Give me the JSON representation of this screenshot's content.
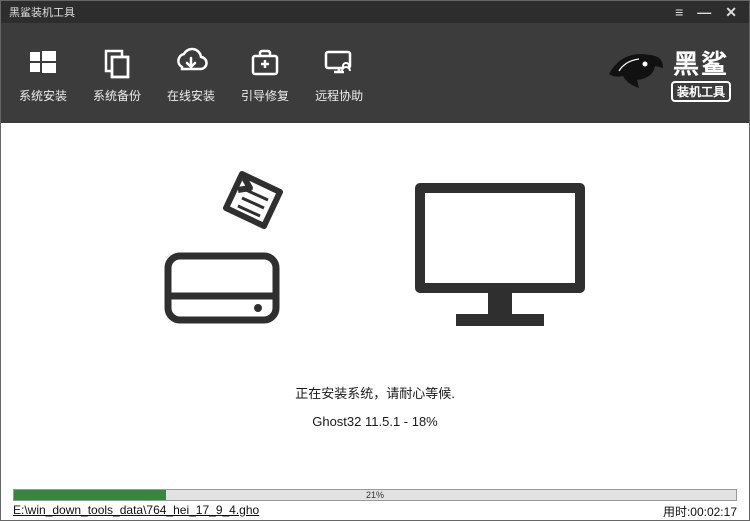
{
  "titlebar": {
    "title": "黑鲨装机工具"
  },
  "tabs": {
    "install": {
      "label": "系统安装"
    },
    "backup": {
      "label": "系统备份"
    },
    "online": {
      "label": "在线安装"
    },
    "bootfix": {
      "label": "引导修复"
    },
    "remote": {
      "label": "远程协助"
    }
  },
  "logo": {
    "brand_big": "黑鲨",
    "brand_small": "装机工具"
  },
  "status": {
    "line1": "正在安装系统，请耐心等候.",
    "line2": "Ghost32 11.5.1 - 18%"
  },
  "progress": {
    "percent": 21,
    "percent_label": "21%",
    "file_path": "E:\\win_down_tools_data\\764_hei_17_9_4.gho",
    "elapsed_prefix": "用时:",
    "elapsed_value": "00:02:17"
  }
}
